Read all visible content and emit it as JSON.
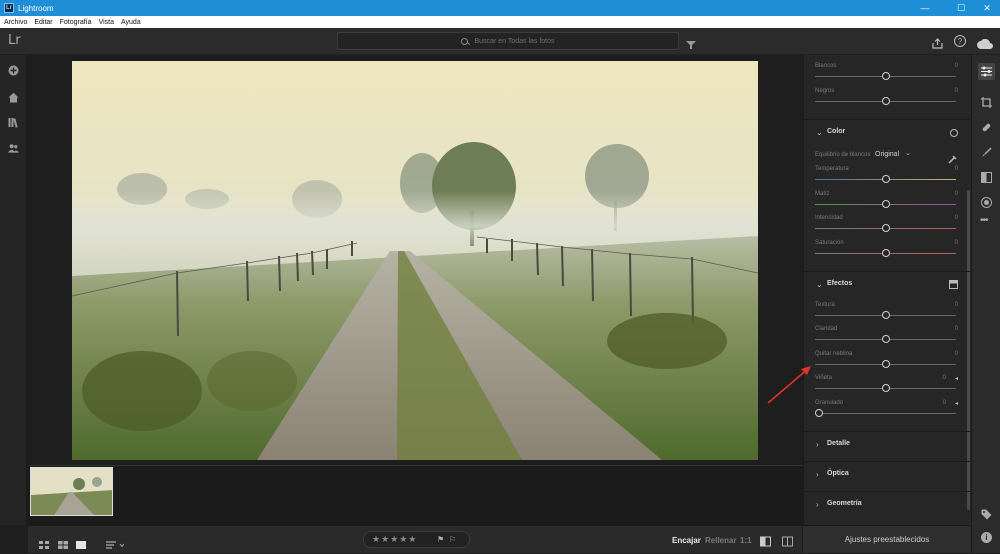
{
  "window": {
    "title": "Lightroom",
    "app_badge": "Lr",
    "minimize": "—",
    "maximize": "☐",
    "close": "✕"
  },
  "menu": [
    "Archivo",
    "Editar",
    "Fotografía",
    "Vista",
    "Ayuda"
  ],
  "topbar": {
    "logo": "Lr",
    "search_placeholder": "Buscar en Todas las fotos",
    "icons": [
      "filter-icon",
      "share-icon",
      "help-icon",
      "cloud-icon"
    ]
  },
  "left_rail": {
    "icons": [
      "add-photos-icon",
      "home-icon",
      "library-icon",
      "people-icon"
    ]
  },
  "right_panel": {
    "sliders_top": [
      {
        "label": "Blancos",
        "value": "0",
        "position": 0.5
      },
      {
        "label": "Negros",
        "value": "0",
        "position": 0.5
      }
    ],
    "color": {
      "title": "Color",
      "wb_label": "Equilibrio de blancos",
      "wb_value": "Original",
      "sliders": [
        {
          "label": "Temperatura",
          "value": "0",
          "position": 0.5
        },
        {
          "label": "Matiz",
          "value": "0",
          "position": 0.5
        },
        {
          "label": "Intensidad",
          "value": "0",
          "position": 0.5
        },
        {
          "label": "Saturación",
          "value": "0",
          "position": 0.5
        }
      ]
    },
    "effects": {
      "title": "Efectos",
      "sliders": [
        {
          "label": "Textura",
          "value": "0",
          "position": 0.5
        },
        {
          "label": "Claridad",
          "value": "0",
          "position": 0.5
        },
        {
          "label": "Quitar neblina",
          "value": "0",
          "position": 0.5
        },
        {
          "label": "Viñeta",
          "value": "0",
          "position": 0.5
        },
        {
          "label": "Granulado",
          "value": "0",
          "position": 0.0
        }
      ]
    },
    "collapsed_sections": [
      "Detalle",
      "Óptica",
      "Geometría"
    ],
    "presets_label": "Ajustes preestablecidos"
  },
  "right_rail": {
    "icons": [
      "edit-sliders-icon",
      "crop-icon",
      "healing-icon",
      "brush-icon",
      "linear-gradient-icon",
      "radial-gradient-icon",
      "more-icon",
      "tag-icon",
      "info-icon"
    ]
  },
  "bottombar": {
    "view_icons": [
      "grid-small-icon",
      "grid-large-icon",
      "single-view-icon"
    ],
    "rating_stars": 5,
    "fit_label": "Encajar",
    "fill_label": "Rellenar",
    "ratio_label": "1:1"
  },
  "colors": {
    "titlebar": "#1e8fd6",
    "panel": "#262626",
    "canvas": "#1e1e1e",
    "annotation_arrow": "#e0322a"
  }
}
